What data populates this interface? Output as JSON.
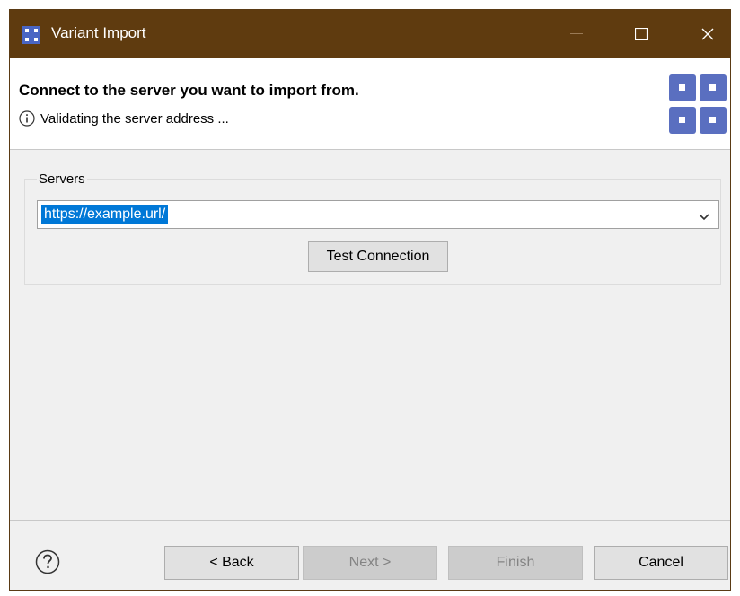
{
  "window": {
    "title": "Variant Import",
    "app_icon": "grid-app-icon",
    "title_bar_color": "#5f3b0f"
  },
  "header": {
    "title": "Connect to the server you want to import from.",
    "message": "Validating the server address ...",
    "message_icon": "info-icon",
    "wizard_icon": "grid-wizard-icon",
    "accent_color": "#5a6fc0"
  },
  "servers": {
    "label": "Servers",
    "value": "https://example.url/",
    "selection_color": "#0078d7",
    "test_button_label": "Test Connection"
  },
  "footer": {
    "help_icon": "help-icon",
    "back_label": "< Back",
    "next_label": "Next >",
    "finish_label": "Finish",
    "cancel_label": "Cancel",
    "next_enabled": false,
    "finish_enabled": false
  }
}
